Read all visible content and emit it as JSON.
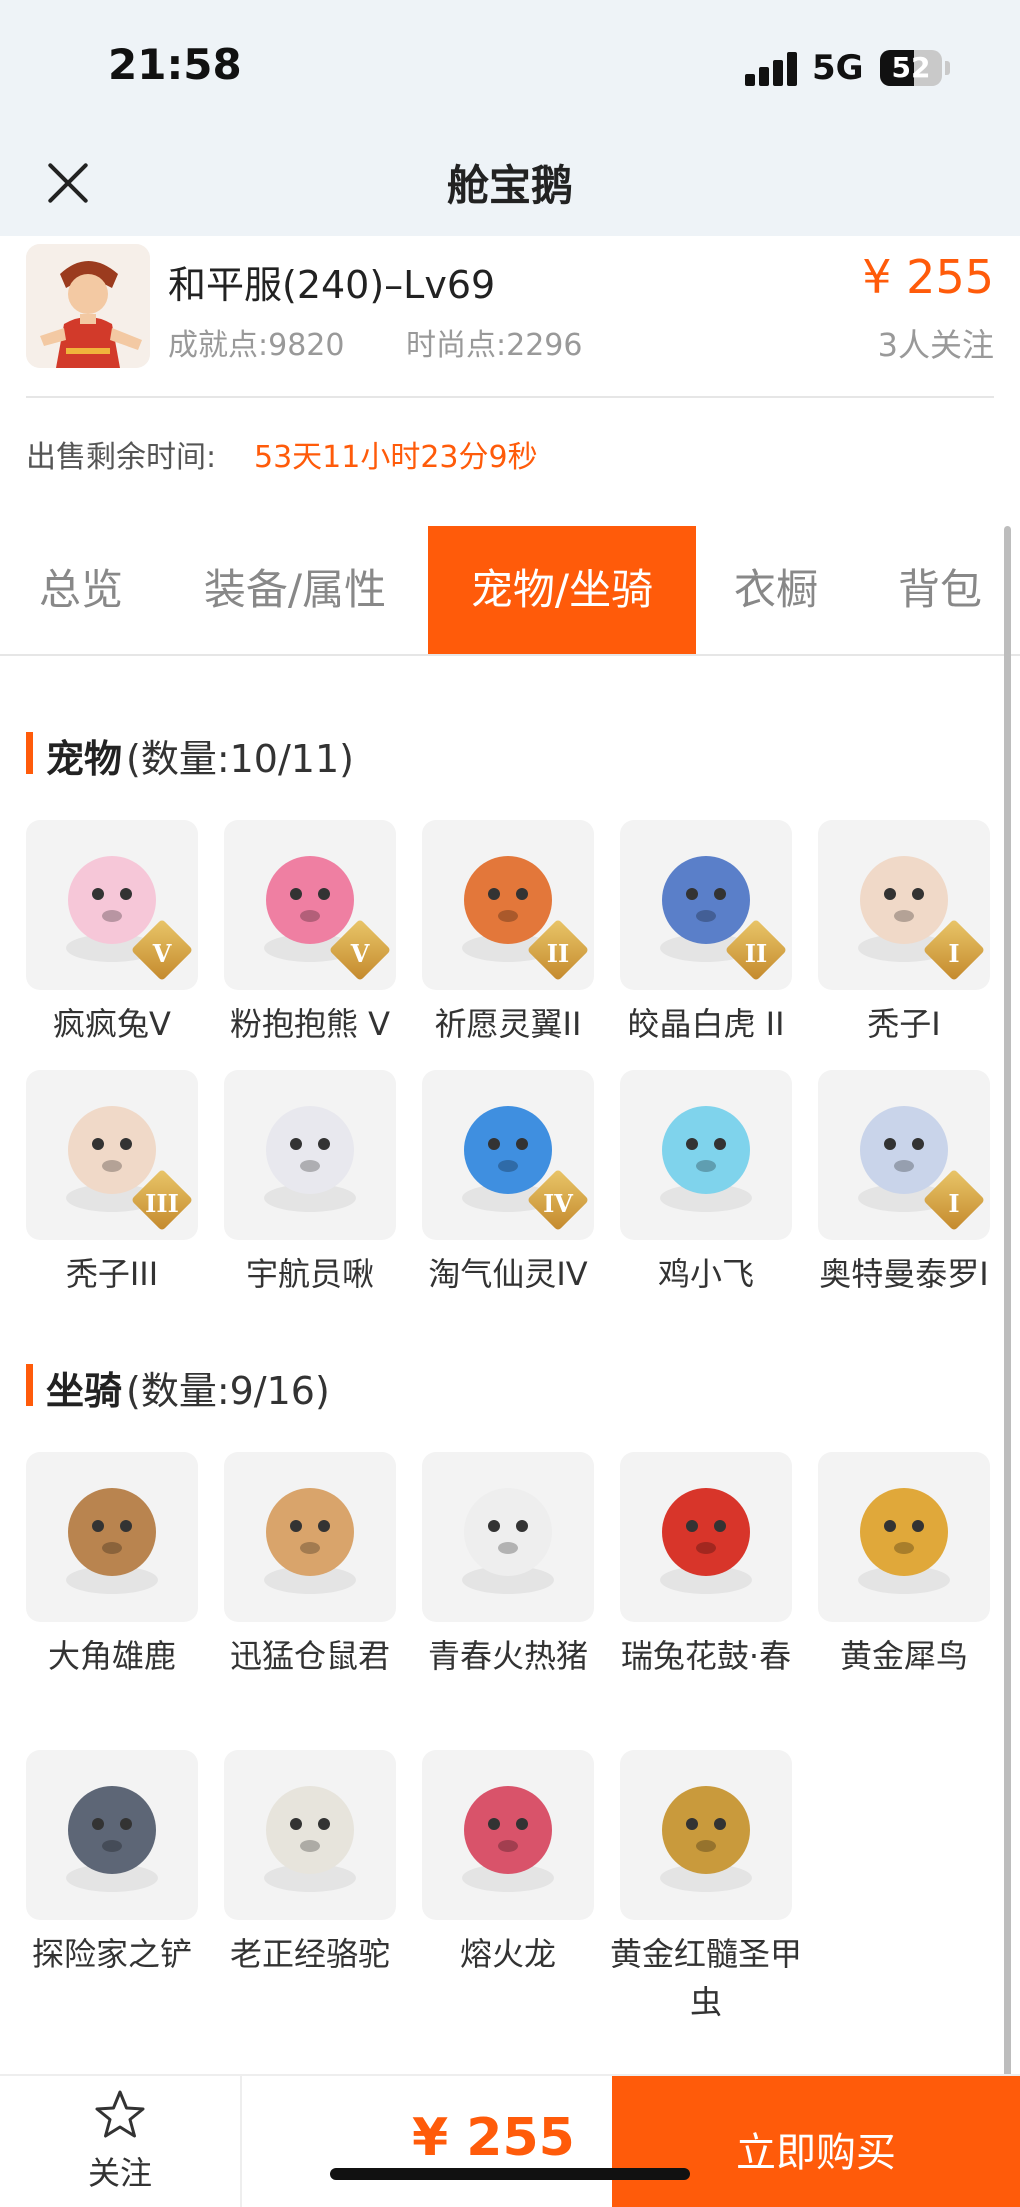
{
  "status_bar": {
    "time": "21:58",
    "network": "5G",
    "battery": "52"
  },
  "nav": {
    "title": "舱宝鹅"
  },
  "product": {
    "title": "和平服(240)–Lv69",
    "achievement": "成就点:9820",
    "fashion": "时尚点:2296",
    "price": "¥ 255",
    "followers": "3人关注"
  },
  "sale": {
    "label": "出售剩余时间:",
    "remaining": "53天11小时23分9秒"
  },
  "tabs": [
    {
      "label": "总览",
      "active": false
    },
    {
      "label": "装备/属性",
      "active": false
    },
    {
      "label": "宠物/坐骑",
      "active": true
    },
    {
      "label": "衣橱",
      "active": false
    },
    {
      "label": "背包",
      "active": false
    }
  ],
  "pets": {
    "title": "宠物",
    "count": "(数量:10/11)",
    "items": [
      {
        "name": "疯疯兔V",
        "badge": "V",
        "icon": "pink-rabbit-icon",
        "color": "#f6c7d8"
      },
      {
        "name": "粉抱抱熊 V",
        "badge": "V",
        "icon": "pink-bear-icon",
        "color": "#ef7fa2"
      },
      {
        "name": "祈愿灵翼II",
        "badge": "II",
        "icon": "eagle-icon",
        "color": "#e3773a"
      },
      {
        "name": "皎晶白虎 II",
        "badge": "II",
        "icon": "white-tiger-icon",
        "color": "#5a7fc9"
      },
      {
        "name": "秃子I",
        "badge": "I",
        "icon": "bald-kid-icon",
        "color": "#f0d9c8"
      },
      {
        "name": "秃子III",
        "badge": "III",
        "icon": "bald-kid-icon",
        "color": "#f0d9c8"
      },
      {
        "name": "宇航员啾",
        "badge": "",
        "icon": "astronaut-icon",
        "color": "#e8e8ee"
      },
      {
        "name": "淘气仙灵IV",
        "badge": "IV",
        "icon": "blue-dog-icon",
        "color": "#3f8fe0"
      },
      {
        "name": "鸡小飞",
        "badge": "",
        "icon": "blue-chick-icon",
        "color": "#7fd3ec"
      },
      {
        "name": "奥特曼泰罗I",
        "badge": "I",
        "icon": "ultraman-icon",
        "color": "#c9d4ea"
      }
    ]
  },
  "mounts": {
    "title": "坐骑",
    "count": "(数量:9/16)",
    "items": [
      {
        "name": "大角雄鹿",
        "icon": "deer-icon",
        "color": "#b9844f"
      },
      {
        "name": "迅猛仓鼠君",
        "icon": "hamster-icon",
        "color": "#d9a46b"
      },
      {
        "name": "青春火热猪",
        "icon": "pig-icon",
        "color": "#eeeeee"
      },
      {
        "name": "瑞兔花鼓·春",
        "icon": "drum-icon",
        "color": "#d8352a"
      },
      {
        "name": "黄金犀鸟",
        "icon": "hornbill-icon",
        "color": "#e0a83a"
      },
      {
        "name": "探险家之铲",
        "icon": "shovel-icon",
        "color": "#5d6676"
      },
      {
        "name": "老正经骆驼",
        "icon": "camel-icon",
        "color": "#e7e4dc"
      },
      {
        "name": "熔火龙",
        "icon": "fire-dragon-icon",
        "color": "#d9536a"
      },
      {
        "name": "黄金红髓圣甲虫",
        "icon": "golden-beetle-icon",
        "color": "#c99a3c"
      }
    ]
  },
  "bottom": {
    "favorite_label": "关注",
    "price": "¥ 255",
    "buy_label": "立即购买"
  },
  "colors": {
    "accent": "#ff5b0a",
    "nav_bg": "#eef3f7"
  }
}
